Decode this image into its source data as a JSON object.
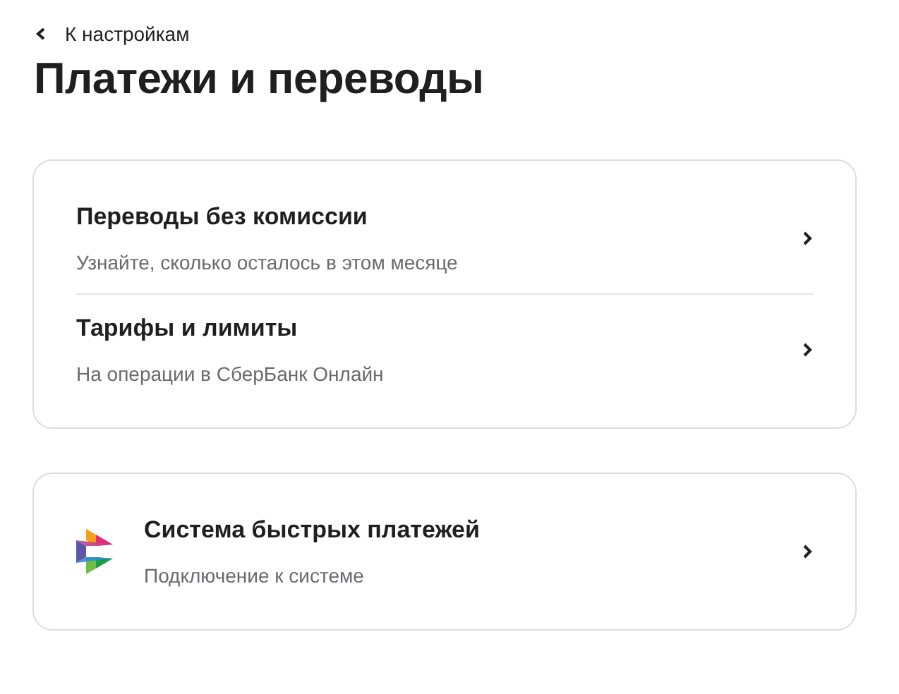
{
  "back_link": {
    "label": "К настройкам"
  },
  "title": "Платежи и переводы",
  "cards": [
    {
      "items": [
        {
          "kind": "plain",
          "title": "Переводы без комиссии",
          "subtitle": "Узнайте, сколько осталось в этом месяце"
        },
        {
          "kind": "plain",
          "title": "Тарифы и лимиты",
          "subtitle": "На операции в СберБанк Онлайн"
        }
      ]
    },
    {
      "items": [
        {
          "kind": "logo",
          "title": "Система быстрых платежей",
          "subtitle": "Подключение к системе"
        }
      ]
    }
  ]
}
